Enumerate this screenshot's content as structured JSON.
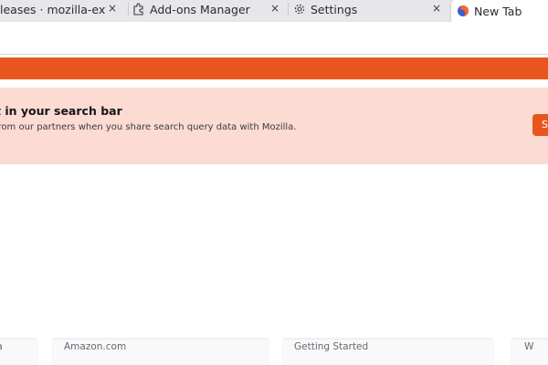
{
  "tabs": [
    {
      "label": "leases · mozilla-extensio",
      "close": "×"
    },
    {
      "label": "Add-ons Manager",
      "close": "×"
    },
    {
      "label": "Settings",
      "close": "×"
    },
    {
      "label": "New Tab"
    }
  ],
  "banner": {
    "title": "t in your search bar",
    "description": "from our partners when you share search query data with Mozilla.",
    "button_label": "S"
  },
  "tiles": [
    {
      "label": "ra"
    },
    {
      "label": "Amazon.com"
    },
    {
      "label": "Getting Started"
    },
    {
      "label": "W"
    }
  ],
  "colors": {
    "accent": "#e9551f",
    "banner_bg": "#fbdbd2",
    "tabbar_bg": "#e7e7ea"
  }
}
